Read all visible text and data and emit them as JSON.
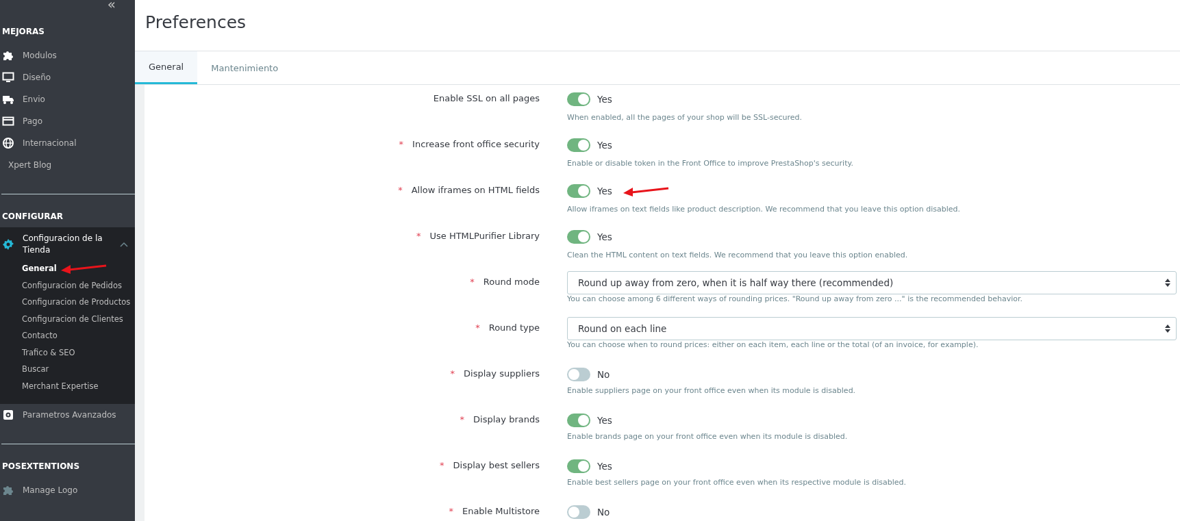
{
  "sidebar": {
    "collapse": "«",
    "sections": [
      {
        "title": "MEJORAS",
        "items": [
          {
            "label": "Modulos",
            "expanded": false,
            "selected": false
          },
          {
            "label": "Diseño",
            "expanded": false,
            "selected": false
          },
          {
            "label": "Envio",
            "expanded": false,
            "selected": false
          },
          {
            "label": "Pago",
            "expanded": false,
            "selected": false
          },
          {
            "label": "Internacional",
            "expanded": false,
            "selected": false
          },
          {
            "label": "Xpert Blog",
            "expanded": false,
            "selected": false
          }
        ]
      },
      {
        "title": "CONFIGURAR",
        "items": [
          {
            "label": "Configuracion de la Tienda",
            "expanded": true,
            "selected": true,
            "children": [
              {
                "label": "General",
                "selected": true
              },
              {
                "label": "Configuracion de Pedidos",
                "selected": false
              },
              {
                "label": "Configuracion de Productos",
                "selected": false
              },
              {
                "label": "Configuracion de Clientes",
                "selected": false
              },
              {
                "label": "Contacto",
                "selected": false
              },
              {
                "label": "Trafico & SEO",
                "selected": false
              },
              {
                "label": "Buscar",
                "selected": false
              },
              {
                "label": "Merchant Expertise",
                "selected": false
              }
            ]
          },
          {
            "label": "Parametros Avanzados",
            "expanded": false,
            "selected": false
          }
        ]
      },
      {
        "title": "POSEXTENTIONS",
        "items": [
          {
            "label": "Manage Logo",
            "expanded": false,
            "selected": false
          }
        ]
      }
    ]
  },
  "header": {
    "title": "Preferences"
  },
  "tabs": [
    {
      "label": "General",
      "selected": true
    },
    {
      "label": "Mantenimiento",
      "selected": false
    }
  ],
  "form": [
    {
      "kind": "toggle",
      "label": "Enable SSL on all pages",
      "on": true,
      "value": "Yes",
      "help": "When enabled, all the pages of your shop will be SSL-secured."
    },
    {
      "kind": "toggle",
      "label": "Increase front office security",
      "marker": "*",
      "on": true,
      "value": "Yes",
      "help": "Enable or disable token in the Front Office to improve PrestaShop's security."
    },
    {
      "kind": "toggle",
      "label": "Allow iframes on HTML fields",
      "marker": "*",
      "on": true,
      "value": "Yes",
      "help": "Allow iframes on text fields like product description. We recommend that you leave this option disabled.",
      "annotated": true
    },
    {
      "kind": "toggle",
      "label": "Use HTMLPurifier Library",
      "marker": "*",
      "on": true,
      "value": "Yes",
      "help": "Clean the HTML content on text fields. We recommend that you leave this option enabled."
    },
    {
      "kind": "select",
      "label": "Round mode",
      "marker": "*",
      "value": "Round up away from zero, when it is half way there (recommended)",
      "help": "You can choose among 6 different ways of rounding prices. \"Round up away from zero ...\" is the recommended behavior."
    },
    {
      "kind": "select",
      "label": "Round type",
      "marker": "*",
      "value": "Round on each line",
      "help": "You can choose when to round prices: either on each item, each line or the total (of an invoice, for example)."
    },
    {
      "kind": "toggle",
      "label": "Display suppliers",
      "marker": "*",
      "on": false,
      "value": "No",
      "help": "Enable suppliers page on your front office even when its module is disabled."
    },
    {
      "kind": "toggle",
      "label": "Display brands",
      "marker": "*",
      "on": true,
      "value": "Yes",
      "help": "Enable brands page on your front office even when its module is disabled."
    },
    {
      "kind": "toggle",
      "label": "Display best sellers",
      "marker": "*",
      "on": true,
      "value": "Yes",
      "help": "Enable best sellers page on your front office even when its respective module is disabled."
    },
    {
      "kind": "toggle",
      "label": "Enable Multistore",
      "marker": "*",
      "on": false,
      "value": "No"
    }
  ]
}
